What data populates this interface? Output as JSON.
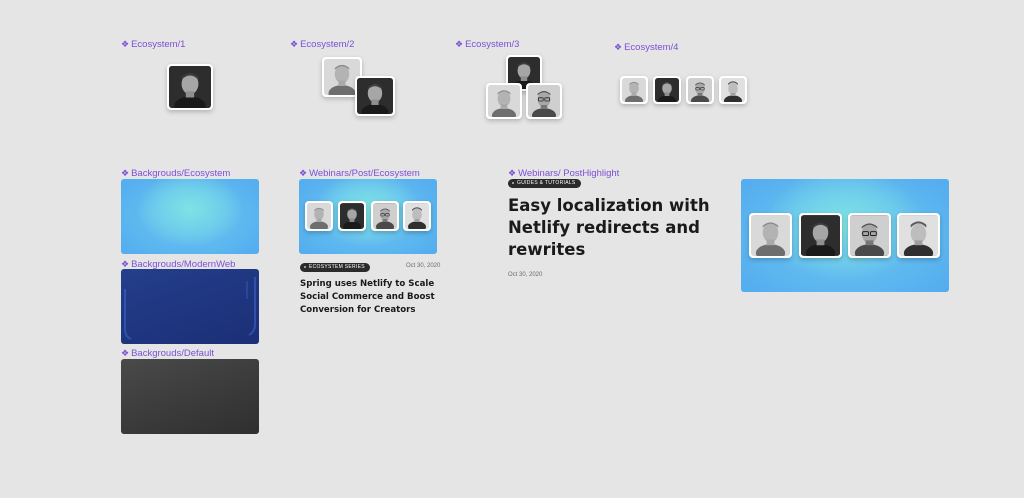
{
  "labels": {
    "ecosystem1": "Ecosystem/1",
    "ecosystem2": "Ecosystem/2",
    "ecosystem3": "Ecosystem/3",
    "ecosystem4": "Ecosystem/4",
    "bg_ecosystem": "Backgrouds/Ecosystem",
    "bg_modernweb": "Backgrouds/ModernWeb",
    "bg_default": "Backgrouds/Default",
    "webinar_post": "Webinars/Post/Ecosystem",
    "webinar_highlight": "Webinars/ PostHighlight"
  },
  "component_icon": "component-diamond-icon",
  "post_card": {
    "badge": "ECOSYSTEM SERIES",
    "date": "Oct 30, 2020",
    "title": "Spring uses Netlify to Scale Social Commerce and Boost Conversion for Creators"
  },
  "highlight_card": {
    "badge": "GUIDES & TUTORIALS",
    "date": "Oct 30, 2020",
    "title": "Easy localization with Netlify redirects and rewrites"
  },
  "colors": {
    "label_purple": "#7b4fd6",
    "canvas": "#e5e5e5",
    "ecosystem_blue": "#4da6ef",
    "ecosystem_cyan": "#7fe3e3",
    "modernweb_navy": "#1f3680",
    "default_gray": "#3c3c3c"
  }
}
